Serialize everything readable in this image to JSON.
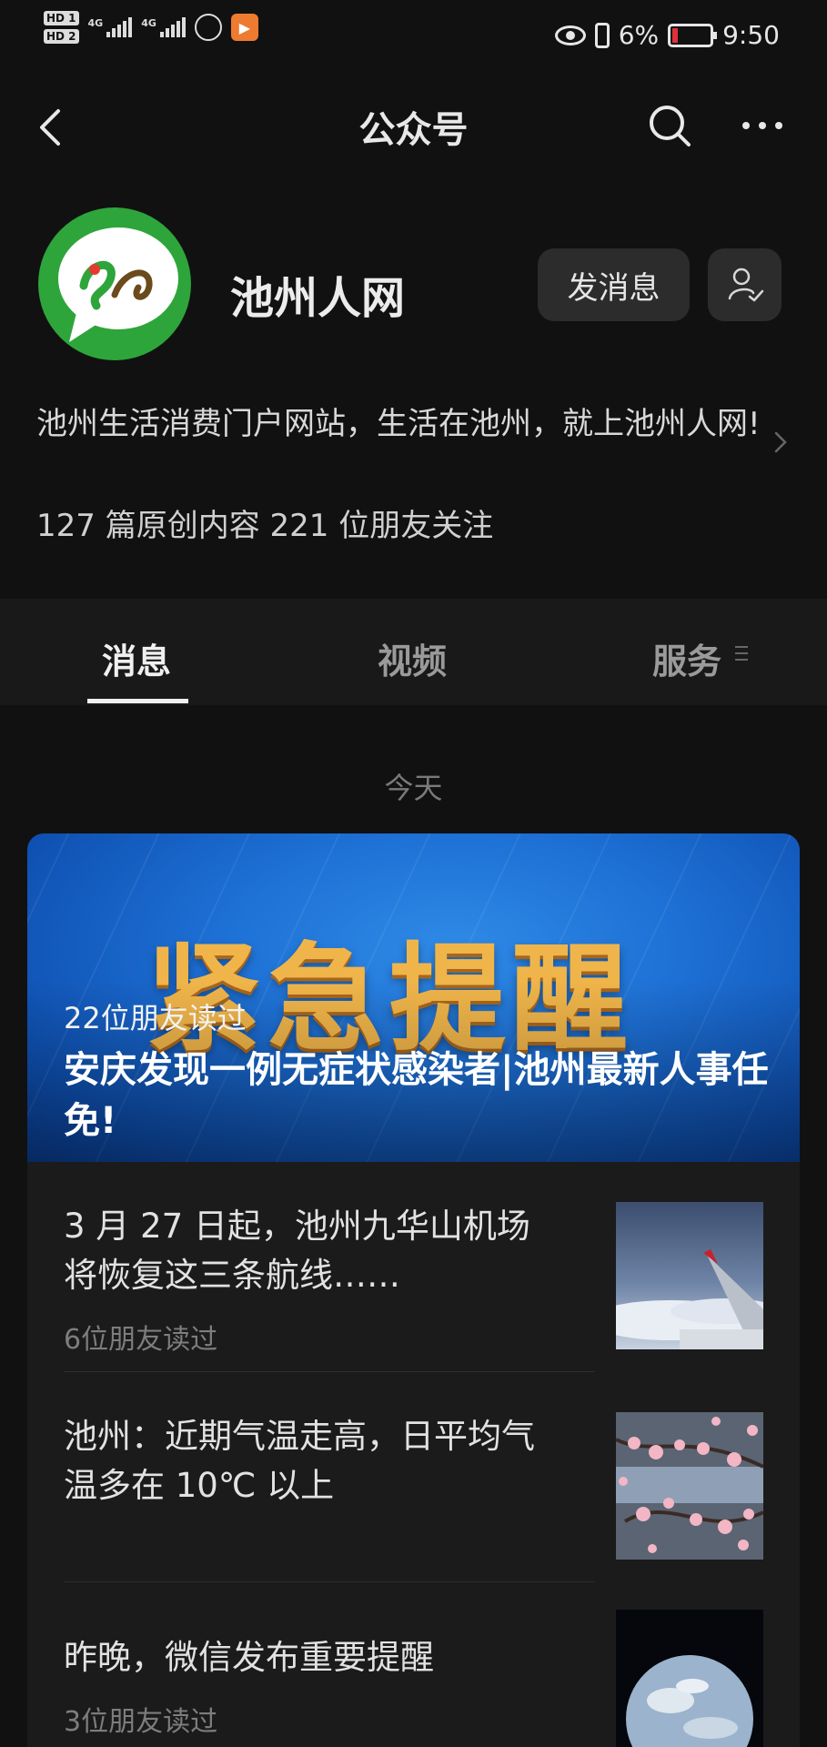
{
  "status_bar": {
    "sim1": "HD 1",
    "sim2": "HD 2",
    "net1": "4G",
    "net2": "4G",
    "battery_percent": "6%",
    "time": "9:50"
  },
  "nav": {
    "title": "公众号"
  },
  "profile": {
    "name": "池州人网",
    "send_message_label": "发消息",
    "description": "池州生活消费门户网站，生活在池州，就上池州人网!",
    "stats": "127 篇原创内容  221 位朋友关注"
  },
  "tabs": [
    {
      "label": "消息",
      "active": true
    },
    {
      "label": "视频",
      "active": false
    },
    {
      "label": "服务",
      "active": false
    }
  ],
  "feed": {
    "date_label": "今天",
    "featured": {
      "banner_text": "紧急提醒",
      "reads": "22位朋友读过",
      "title": "安庆发现一例无症状感染者|池州最新人事任免!"
    },
    "articles": [
      {
        "title": "3 月 27 日起，池州九华山机场将恢复这三条航线……",
        "reads": "6位朋友读过",
        "thumb": "airplane-wing"
      },
      {
        "title": "池州：近期气温走高，日平均气温多在 10℃ 以上",
        "reads": "",
        "thumb": "plum-blossoms"
      },
      {
        "title": "昨晚，微信发布重要提醒",
        "reads": "3位朋友读过",
        "thumb": "earth"
      }
    ]
  }
}
